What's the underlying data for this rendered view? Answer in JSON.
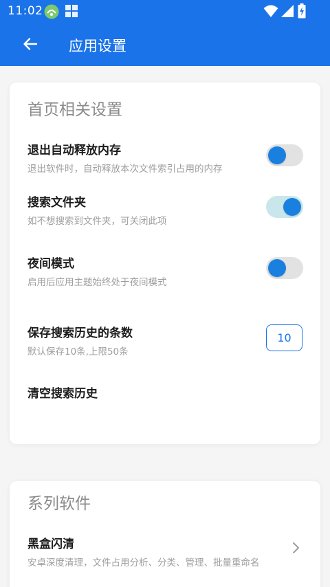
{
  "status_bar": {
    "time": "11:02"
  },
  "app_bar": {
    "title": "应用设置"
  },
  "home_section": {
    "title": "首页相关设置",
    "items": [
      {
        "label": "退出自动释放内存",
        "desc": "退出软件时，自动释放本次文件索引占用的内存",
        "toggle_on": false
      },
      {
        "label": "搜索文件夹",
        "desc": "如不想搜索到文件夹，可关闭此项",
        "toggle_on": true
      },
      {
        "label": "夜间模式",
        "desc": "启用后应用主题始终处于夜间模式",
        "toggle_on": false
      }
    ],
    "history_count": {
      "label": "保存搜索历史的条数",
      "desc": "默认保存10条,上限50条",
      "value": "10"
    },
    "clear_history": {
      "label": "清空搜索历史"
    }
  },
  "series_section": {
    "title": "系列软件",
    "items": [
      {
        "label": "黑盒闪清",
        "desc": "安卓深度清理，文件占用分析、分类、管理、批量重命名"
      }
    ]
  },
  "colors": {
    "primary": "#1a73e8",
    "toggle_knob": "#1a80e0",
    "toggle_track_on": "#c9e7ea",
    "toggle_track_off": "#e2e2e2"
  }
}
